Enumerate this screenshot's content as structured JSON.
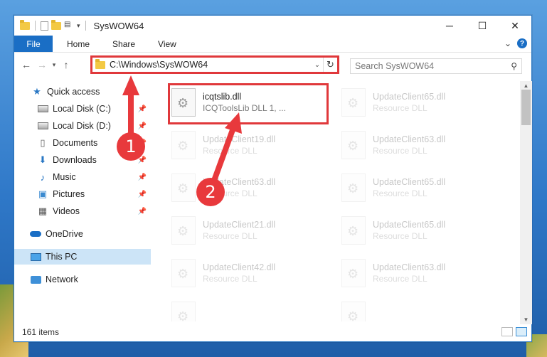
{
  "window": {
    "title": "SysWOW64",
    "controls": {
      "minimize": "─",
      "maximize": "☐",
      "close": "✕"
    }
  },
  "ribbon": {
    "tabs": [
      "File",
      "Home",
      "Share",
      "View"
    ],
    "expand_icon": "⌄",
    "help": "?"
  },
  "address": {
    "path": "C:\\Windows\\SysWOW64",
    "search_placeholder": "Search SysWOW64"
  },
  "nav": {
    "items": [
      {
        "label": "Quick access",
        "icon": "star-icon",
        "pinned": false
      },
      {
        "label": "Local Disk (C:)",
        "icon": "drive-icon",
        "pinned": true
      },
      {
        "label": "Local Disk (D:)",
        "icon": "drive-icon",
        "pinned": true
      },
      {
        "label": "Documents",
        "icon": "documents-icon",
        "pinned": true
      },
      {
        "label": "Downloads",
        "icon": "downloads-icon",
        "pinned": true
      },
      {
        "label": "Music",
        "icon": "music-icon",
        "pinned": true
      },
      {
        "label": "Pictures",
        "icon": "pictures-icon",
        "pinned": true
      },
      {
        "label": "Videos",
        "icon": "videos-icon",
        "pinned": true
      },
      {
        "label": "OneDrive",
        "icon": "onedrive-icon",
        "pinned": false
      },
      {
        "label": "This PC",
        "icon": "pc-icon",
        "pinned": false,
        "selected": true
      },
      {
        "label": "Network",
        "icon": "network-icon",
        "pinned": false
      }
    ]
  },
  "files": [
    {
      "name": "icqtslib.dll",
      "desc": "ICQToolsLib DLL 1, ..."
    },
    {
      "name": "UpdateClient65.dll",
      "desc": "Resource DLL"
    },
    {
      "name": "UpdateClient19.dll",
      "desc": "Resource DLL"
    },
    {
      "name": "UpdateClient63.dll",
      "desc": "Resource DLL"
    },
    {
      "name": "UpdateClient63.dll",
      "desc": "Resource DLL"
    },
    {
      "name": "UpdateClient65.dll",
      "desc": "Resource DLL"
    },
    {
      "name": "UpdateClient21.dll",
      "desc": "Resource DLL"
    },
    {
      "name": "UpdateClient65.dll",
      "desc": "Resource DLL"
    },
    {
      "name": "UpdateClient42.dll",
      "desc": "Resource DLL"
    },
    {
      "name": "UpdateClient63.dll",
      "desc": "Resource DLL"
    }
  ],
  "status": {
    "item_count": "161 items"
  },
  "annotations": {
    "step1": "1",
    "step2": "2"
  },
  "colors": {
    "accent": "#1a6ec5",
    "highlight": "#e0383b",
    "badge": "#e8393c"
  }
}
